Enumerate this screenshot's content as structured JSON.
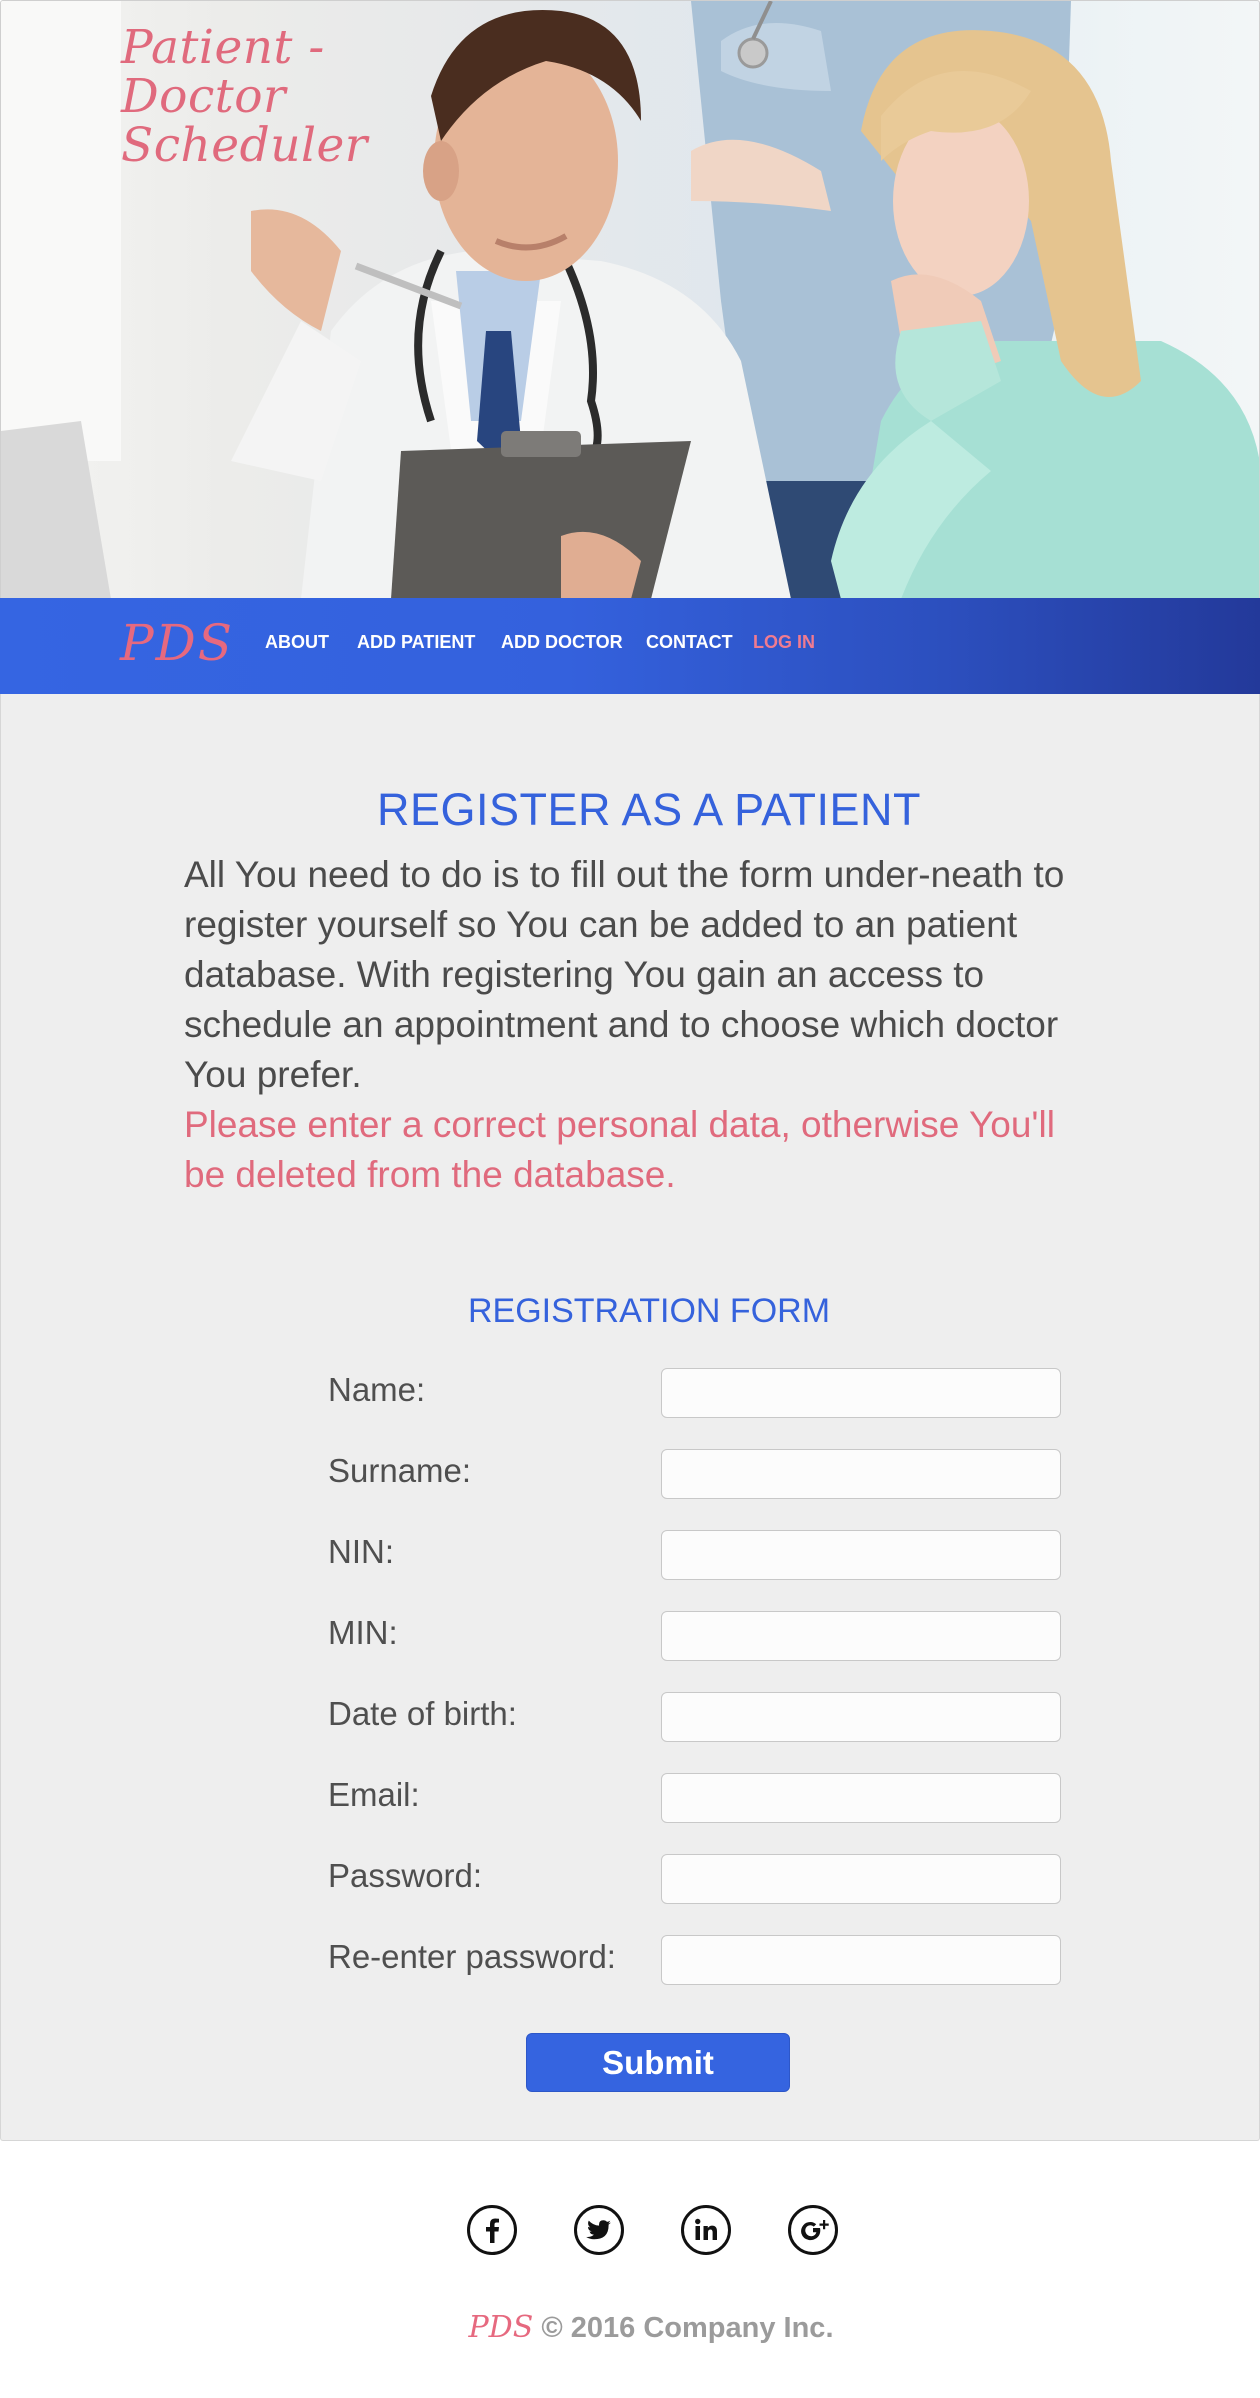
{
  "hero": {
    "title_line1": "Patient - Doctor",
    "title_line2": "Scheduler"
  },
  "navbar": {
    "logo": "PDS",
    "items": [
      {
        "label": "ABOUT"
      },
      {
        "label": "ADD PATIENT"
      },
      {
        "label": "ADD DOCTOR"
      },
      {
        "label": "CONTACT"
      },
      {
        "label": "LOG IN"
      }
    ]
  },
  "register": {
    "title": "REGISTER AS A PATIENT",
    "intro": "All You need to do is to fill out the form under-neath to register yourself so You can be added to an patient database. With registering You gain an access to schedule an appointment and to choose which doctor You prefer.",
    "warning": "Please enter a correct personal data, otherwise You'll be deleted from the database."
  },
  "form": {
    "title": "REGISTRATION FORM",
    "fields": [
      {
        "label": "Name:",
        "value": ""
      },
      {
        "label": "Surname:",
        "value": ""
      },
      {
        "label": "NIN:",
        "value": ""
      },
      {
        "label": "MIN:",
        "value": ""
      },
      {
        "label": "Date of birth:",
        "value": ""
      },
      {
        "label": "Email:",
        "value": ""
      },
      {
        "label": "Password:",
        "value": ""
      },
      {
        "label": "Re-enter password:",
        "value": ""
      }
    ],
    "submit_label": "Submit"
  },
  "footer": {
    "social_icons": [
      "facebook-icon",
      "twitter-icon",
      "linkedin-icon",
      "google-plus-icon"
    ],
    "logo": "PDS",
    "copyright": "© 2016 Company Inc."
  },
  "colors": {
    "brand_blue": "#3562dc",
    "accent_pink": "#e06a7d",
    "background": "#eeeeee"
  }
}
